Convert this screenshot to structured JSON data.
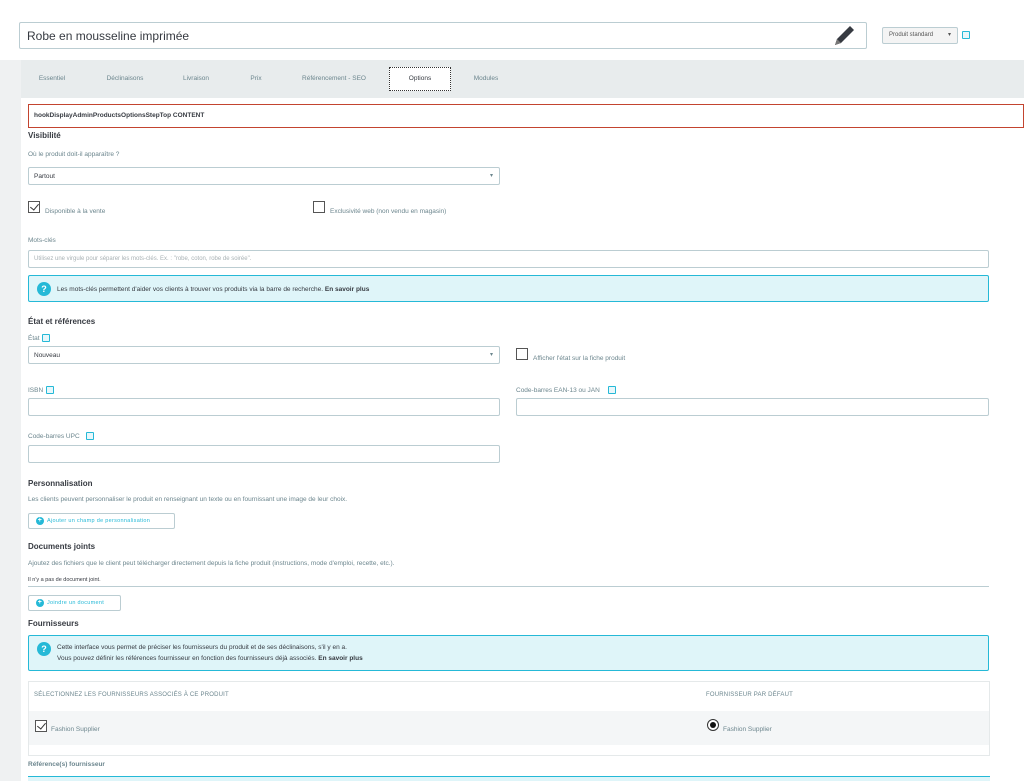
{
  "header": {
    "product_name": "Robe en mousseline imprimée",
    "product_type": "Produit standard"
  },
  "tabs": [
    {
      "label": "Essentiel"
    },
    {
      "label": "Déclinaisons"
    },
    {
      "label": "Livraison"
    },
    {
      "label": "Prix"
    },
    {
      "label": "Référencement - SEO"
    },
    {
      "label": "Options"
    },
    {
      "label": "Modules"
    }
  ],
  "active_tab": "Options",
  "hook_text": "hookDisplayAdminProductsOptionsStepTop CONTENT",
  "visibility": {
    "title": "Visibilité",
    "question": "Où le produit doit-il apparaître ?",
    "selected": "Partout",
    "available_label": "Disponible à la vente",
    "available_checked": true,
    "web_only_label": "Exclusivité web (non vendu en magasin)",
    "web_only_checked": false
  },
  "keywords": {
    "label": "Mots-clés",
    "placeholder": "Utilisez une virgule pour séparer les mots-clés. Ex. : \"robe, coton, robe de soirée\".",
    "info": "Les mots-clés permettent d'aider vos clients à trouver vos produits via la barre de recherche.",
    "info_link": "En savoir plus"
  },
  "condition": {
    "title": "État et références",
    "state_label": "État",
    "state_value": "Nouveau",
    "show_state_label": "Afficher l'état sur la fiche produit",
    "show_state_checked": false,
    "isbn_label": "ISBN",
    "ean_label": "Code-barres EAN-13 ou JAN",
    "upc_label": "Code-barres UPC"
  },
  "customization": {
    "title": "Personnalisation",
    "description": "Les clients peuvent personnaliser le produit en renseignant un texte ou en fournissant une image de leur choix.",
    "button": "Ajouter un champ de personnalisation"
  },
  "attachments": {
    "title": "Documents joints",
    "description": "Ajoutez des fichiers que le client peut télécharger directement depuis la fiche produit (instructions, mode d'emploi, recette, etc.).",
    "empty": "Il n'y a pas de document joint.",
    "button": "Joindre un document"
  },
  "suppliers": {
    "title": "Fournisseurs",
    "info_line1": "Cette interface vous permet de préciser les fournisseurs du produit et de ses déclinaisons, s'il y en a.",
    "info_line2": "Vous pouvez définir les références fournisseur en fonction des fournisseurs déjà associés.",
    "info_link": "En savoir plus",
    "col_select": "SÉLECTIONNEZ LES FOURNISSEURS ASSOCIÉS À CE PRODUIT",
    "col_default": "FOURNISSEUR PAR DÉFAUT",
    "row_supplier": "Fashion Supplier",
    "row_checked": true,
    "row_default": "Fashion Supplier",
    "refs_title": "Référence(s) fournisseur"
  },
  "colors": {
    "accent": "#25b9d7",
    "hook_border": "#c3442f",
    "info_bg": "#dff5f9"
  }
}
